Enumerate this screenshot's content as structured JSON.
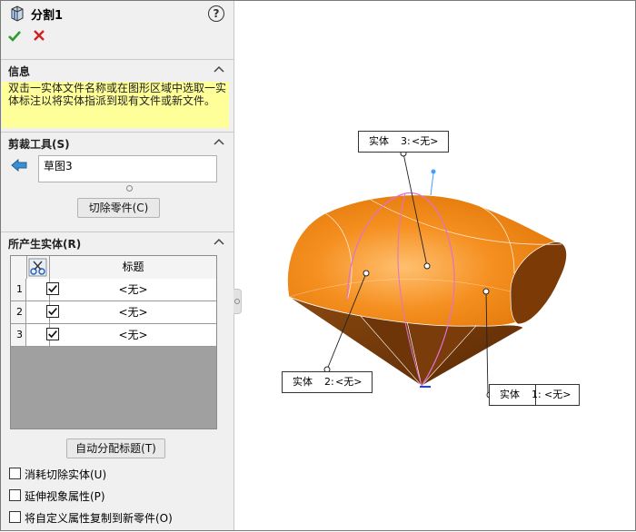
{
  "feature": {
    "title": "分割1",
    "icon": "split-feature-icon",
    "help": "?"
  },
  "actions": {
    "ok_icon": "checkmark-icon",
    "cancel_icon": "cross-icon",
    "ok_color": "#2e9b2e",
    "cancel_color": "#d02020"
  },
  "info": {
    "header": "信息",
    "text": "双击一实体文件名称或在图形区域中选取一实体标注以将实体指派到现有文件或新文件。"
  },
  "trim_tools": {
    "header": "剪裁工具(S)",
    "selected": "草图3",
    "cut_button": "切除零件(C)"
  },
  "bodies": {
    "header": "所产生实体(R)",
    "column_header": "标题",
    "rows": [
      {
        "num": "1",
        "checked": true,
        "value": "<无>"
      },
      {
        "num": "2",
        "checked": true,
        "value": "<无>"
      },
      {
        "num": "3",
        "checked": true,
        "value": "<无>"
      }
    ],
    "auto_button": "自动分配标题(T)"
  },
  "options": [
    {
      "label": "消耗切除实体(U)",
      "checked": false
    },
    {
      "label": "延伸视象属性(P)",
      "checked": false
    },
    {
      "label": "将自定义属性复制到新零件(O)",
      "checked": false
    }
  ],
  "callouts": [
    {
      "body": "实体",
      "num": "3:",
      "name": "<无>"
    },
    {
      "body": "实体",
      "num": "2:",
      "name": "<无>"
    },
    {
      "body": "实体",
      "num": "1:",
      "name": "<无>"
    }
  ],
  "model": {
    "color": "#f28a1c",
    "shadow": "#6b3105",
    "sketch_color": "#e070d0"
  }
}
